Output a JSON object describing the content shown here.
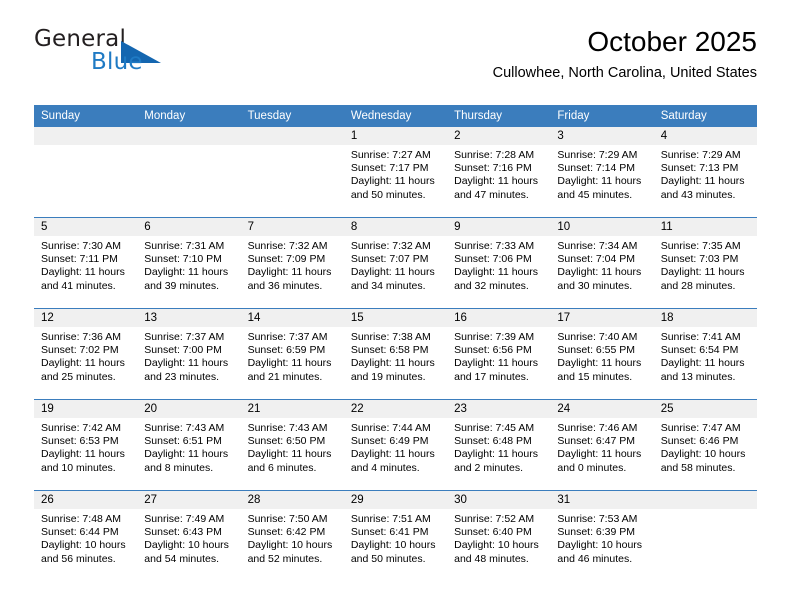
{
  "brand": {
    "name_part1": "General",
    "name_part2": "Blue",
    "triangle_icon": "triangle-icon",
    "accent_color": "#1f7ac4",
    "triangle_color": "#1466b0"
  },
  "header": {
    "title": "October 2025",
    "location": "Cullowhee, North Carolina, United States"
  },
  "theme": {
    "header_blue": "#3b7dbd",
    "day_band_gray": "#f0f0f0",
    "text_black": "#000000"
  },
  "calendar": {
    "weekdays": [
      "Sunday",
      "Monday",
      "Tuesday",
      "Wednesday",
      "Thursday",
      "Friday",
      "Saturday"
    ],
    "weeks": [
      [
        {
          "day": "",
          "sunrise": "",
          "sunset": "",
          "daylight1": "",
          "daylight2": ""
        },
        {
          "day": "",
          "sunrise": "",
          "sunset": "",
          "daylight1": "",
          "daylight2": ""
        },
        {
          "day": "",
          "sunrise": "",
          "sunset": "",
          "daylight1": "",
          "daylight2": ""
        },
        {
          "day": "1",
          "sunrise": "Sunrise: 7:27 AM",
          "sunset": "Sunset: 7:17 PM",
          "daylight1": "Daylight: 11 hours",
          "daylight2": "and 50 minutes."
        },
        {
          "day": "2",
          "sunrise": "Sunrise: 7:28 AM",
          "sunset": "Sunset: 7:16 PM",
          "daylight1": "Daylight: 11 hours",
          "daylight2": "and 47 minutes."
        },
        {
          "day": "3",
          "sunrise": "Sunrise: 7:29 AM",
          "sunset": "Sunset: 7:14 PM",
          "daylight1": "Daylight: 11 hours",
          "daylight2": "and 45 minutes."
        },
        {
          "day": "4",
          "sunrise": "Sunrise: 7:29 AM",
          "sunset": "Sunset: 7:13 PM",
          "daylight1": "Daylight: 11 hours",
          "daylight2": "and 43 minutes."
        }
      ],
      [
        {
          "day": "5",
          "sunrise": "Sunrise: 7:30 AM",
          "sunset": "Sunset: 7:11 PM",
          "daylight1": "Daylight: 11 hours",
          "daylight2": "and 41 minutes."
        },
        {
          "day": "6",
          "sunrise": "Sunrise: 7:31 AM",
          "sunset": "Sunset: 7:10 PM",
          "daylight1": "Daylight: 11 hours",
          "daylight2": "and 39 minutes."
        },
        {
          "day": "7",
          "sunrise": "Sunrise: 7:32 AM",
          "sunset": "Sunset: 7:09 PM",
          "daylight1": "Daylight: 11 hours",
          "daylight2": "and 36 minutes."
        },
        {
          "day": "8",
          "sunrise": "Sunrise: 7:32 AM",
          "sunset": "Sunset: 7:07 PM",
          "daylight1": "Daylight: 11 hours",
          "daylight2": "and 34 minutes."
        },
        {
          "day": "9",
          "sunrise": "Sunrise: 7:33 AM",
          "sunset": "Sunset: 7:06 PM",
          "daylight1": "Daylight: 11 hours",
          "daylight2": "and 32 minutes."
        },
        {
          "day": "10",
          "sunrise": "Sunrise: 7:34 AM",
          "sunset": "Sunset: 7:04 PM",
          "daylight1": "Daylight: 11 hours",
          "daylight2": "and 30 minutes."
        },
        {
          "day": "11",
          "sunrise": "Sunrise: 7:35 AM",
          "sunset": "Sunset: 7:03 PM",
          "daylight1": "Daylight: 11 hours",
          "daylight2": "and 28 minutes."
        }
      ],
      [
        {
          "day": "12",
          "sunrise": "Sunrise: 7:36 AM",
          "sunset": "Sunset: 7:02 PM",
          "daylight1": "Daylight: 11 hours",
          "daylight2": "and 25 minutes."
        },
        {
          "day": "13",
          "sunrise": "Sunrise: 7:37 AM",
          "sunset": "Sunset: 7:00 PM",
          "daylight1": "Daylight: 11 hours",
          "daylight2": "and 23 minutes."
        },
        {
          "day": "14",
          "sunrise": "Sunrise: 7:37 AM",
          "sunset": "Sunset: 6:59 PM",
          "daylight1": "Daylight: 11 hours",
          "daylight2": "and 21 minutes."
        },
        {
          "day": "15",
          "sunrise": "Sunrise: 7:38 AM",
          "sunset": "Sunset: 6:58 PM",
          "daylight1": "Daylight: 11 hours",
          "daylight2": "and 19 minutes."
        },
        {
          "day": "16",
          "sunrise": "Sunrise: 7:39 AM",
          "sunset": "Sunset: 6:56 PM",
          "daylight1": "Daylight: 11 hours",
          "daylight2": "and 17 minutes."
        },
        {
          "day": "17",
          "sunrise": "Sunrise: 7:40 AM",
          "sunset": "Sunset: 6:55 PM",
          "daylight1": "Daylight: 11 hours",
          "daylight2": "and 15 minutes."
        },
        {
          "day": "18",
          "sunrise": "Sunrise: 7:41 AM",
          "sunset": "Sunset: 6:54 PM",
          "daylight1": "Daylight: 11 hours",
          "daylight2": "and 13 minutes."
        }
      ],
      [
        {
          "day": "19",
          "sunrise": "Sunrise: 7:42 AM",
          "sunset": "Sunset: 6:53 PM",
          "daylight1": "Daylight: 11 hours",
          "daylight2": "and 10 minutes."
        },
        {
          "day": "20",
          "sunrise": "Sunrise: 7:43 AM",
          "sunset": "Sunset: 6:51 PM",
          "daylight1": "Daylight: 11 hours",
          "daylight2": "and 8 minutes."
        },
        {
          "day": "21",
          "sunrise": "Sunrise: 7:43 AM",
          "sunset": "Sunset: 6:50 PM",
          "daylight1": "Daylight: 11 hours",
          "daylight2": "and 6 minutes."
        },
        {
          "day": "22",
          "sunrise": "Sunrise: 7:44 AM",
          "sunset": "Sunset: 6:49 PM",
          "daylight1": "Daylight: 11 hours",
          "daylight2": "and 4 minutes."
        },
        {
          "day": "23",
          "sunrise": "Sunrise: 7:45 AM",
          "sunset": "Sunset: 6:48 PM",
          "daylight1": "Daylight: 11 hours",
          "daylight2": "and 2 minutes."
        },
        {
          "day": "24",
          "sunrise": "Sunrise: 7:46 AM",
          "sunset": "Sunset: 6:47 PM",
          "daylight1": "Daylight: 11 hours",
          "daylight2": "and 0 minutes."
        },
        {
          "day": "25",
          "sunrise": "Sunrise: 7:47 AM",
          "sunset": "Sunset: 6:46 PM",
          "daylight1": "Daylight: 10 hours",
          "daylight2": "and 58 minutes."
        }
      ],
      [
        {
          "day": "26",
          "sunrise": "Sunrise: 7:48 AM",
          "sunset": "Sunset: 6:44 PM",
          "daylight1": "Daylight: 10 hours",
          "daylight2": "and 56 minutes."
        },
        {
          "day": "27",
          "sunrise": "Sunrise: 7:49 AM",
          "sunset": "Sunset: 6:43 PM",
          "daylight1": "Daylight: 10 hours",
          "daylight2": "and 54 minutes."
        },
        {
          "day": "28",
          "sunrise": "Sunrise: 7:50 AM",
          "sunset": "Sunset: 6:42 PM",
          "daylight1": "Daylight: 10 hours",
          "daylight2": "and 52 minutes."
        },
        {
          "day": "29",
          "sunrise": "Sunrise: 7:51 AM",
          "sunset": "Sunset: 6:41 PM",
          "daylight1": "Daylight: 10 hours",
          "daylight2": "and 50 minutes."
        },
        {
          "day": "30",
          "sunrise": "Sunrise: 7:52 AM",
          "sunset": "Sunset: 6:40 PM",
          "daylight1": "Daylight: 10 hours",
          "daylight2": "and 48 minutes."
        },
        {
          "day": "31",
          "sunrise": "Sunrise: 7:53 AM",
          "sunset": "Sunset: 6:39 PM",
          "daylight1": "Daylight: 10 hours",
          "daylight2": "and 46 minutes."
        },
        {
          "day": "",
          "sunrise": "",
          "sunset": "",
          "daylight1": "",
          "daylight2": ""
        }
      ]
    ]
  }
}
